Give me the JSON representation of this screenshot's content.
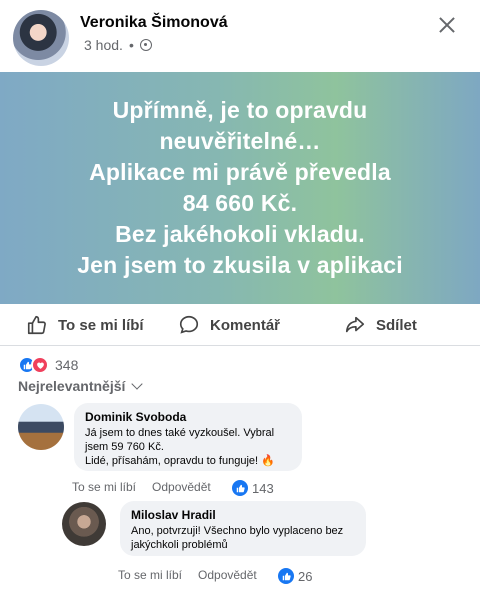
{
  "post": {
    "author": "Veronika Šimonová",
    "time": "3 hod.",
    "dot": "•",
    "banner_lines": [
      "Upřímně, je to opravdu",
      "neuvěřitelné…",
      "Aplikace mi právě převedla",
      "84 660 Kč.",
      "Bez jakéhokoli vkladu.",
      "Jen jsem to zkusila v aplikaci"
    ]
  },
  "actions": {
    "like": "To se mi líbí",
    "comment": "Komentář",
    "share": "Sdílet"
  },
  "reactions": {
    "count": "348",
    "sort_label": "Nejrelevantnější"
  },
  "comments": [
    {
      "author": "Dominik Svoboda",
      "lines": [
        "Já jsem to dnes také vyzkoušel. Vybral",
        "jsem 59 760 Kč.",
        " Lidé, přísahám, opravdu to funguje! 🔥"
      ],
      "like_label": "To se mi líbí",
      "reply_label": "Odpovědět",
      "likes": "143"
    },
    {
      "author": "Miloslav Hradil",
      "lines": [
        "Ano, potvrzuji! Všechno bylo vyplaceno bez",
        "jakýchkoli problémů"
      ],
      "like_label": "To se mi líbí",
      "reply_label": "Odpovědět",
      "likes": "26"
    }
  ]
}
